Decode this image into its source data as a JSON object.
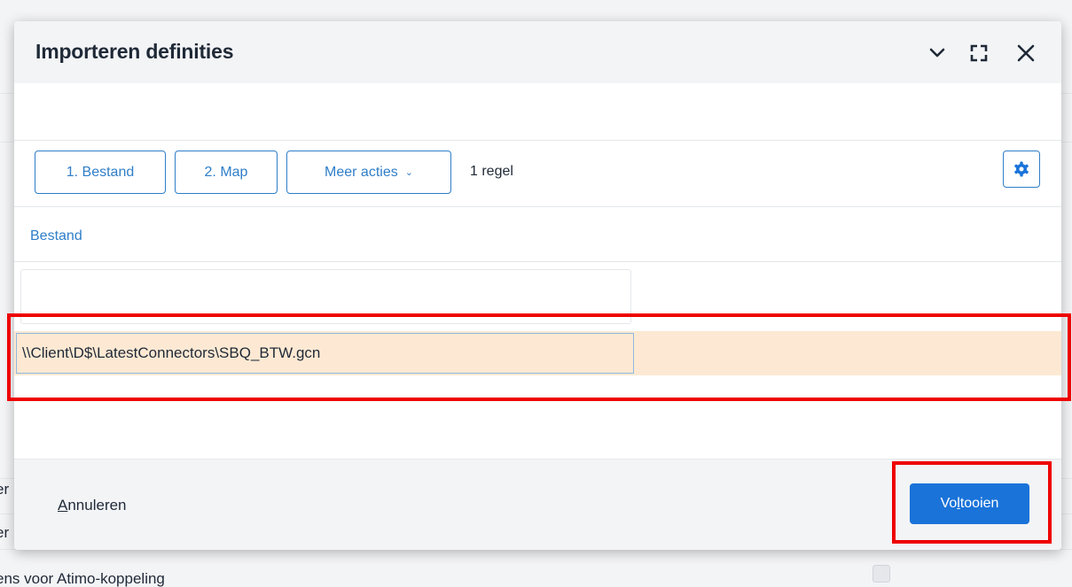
{
  "background": {
    "text_lines": [
      "er",
      "er",
      "ens voor Atimo-koppeling"
    ]
  },
  "dialog": {
    "title": "Importeren definities",
    "header_icons": [
      "chevron-down-icon",
      "expand-icon",
      "close-icon"
    ]
  },
  "toolbar": {
    "btn_file": "1. Bestand",
    "btn_folder": "2. Map",
    "btn_more": "Meer acties",
    "row_count": "1 regel",
    "settings_icon": "gear-icon"
  },
  "grid": {
    "column_header": "Bestand",
    "filter_value": "",
    "rows": [
      {
        "file": "\\\\Client\\D$\\LatestConnectors\\SBQ_BTW.gcn"
      }
    ]
  },
  "footer": {
    "cancel_first": "A",
    "cancel_rest": "nnuleren",
    "finish_pre": "Vo",
    "finish_key": "l",
    "finish_post": "tooien"
  },
  "colors": {
    "accent": "#2f7ec8",
    "primary_button": "#1a73d9",
    "selected_row": "#fde9d3",
    "annotation": "#ee0000",
    "header_bg": "#f3f4f6"
  }
}
